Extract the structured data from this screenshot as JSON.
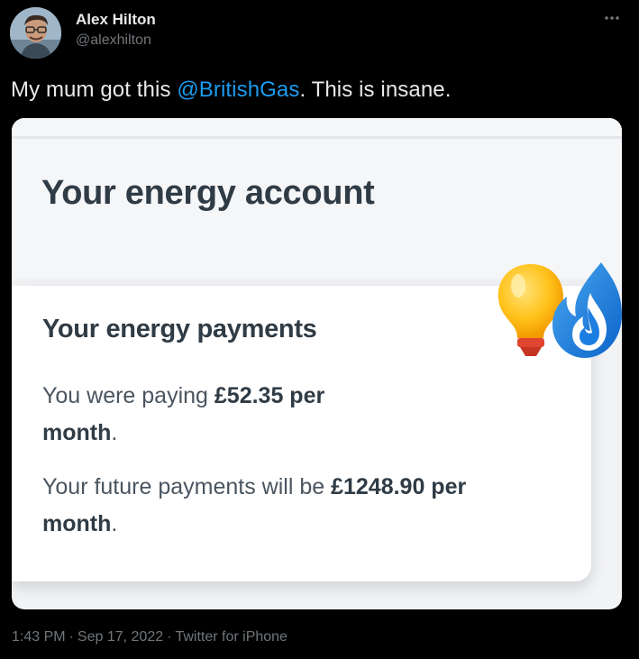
{
  "author": {
    "name": "Alex Hilton",
    "handle": "@alexhilton"
  },
  "tweet": {
    "text_before": "My mum got this ",
    "mention": "@BritishGas",
    "text_after": ". This is insane."
  },
  "media": {
    "account_title": "Your energy account",
    "payments_title": "Your energy payments",
    "line1_prefix": "You were paying ",
    "line1_amount": "£52.35 per",
    "line1_amount_cont": "month",
    "line1_suffix": ".",
    "line2_prefix": "Your future payments will be ",
    "line2_amount": "£1248.90 per",
    "line2_amount_cont": "month",
    "line2_suffix": ".",
    "icons": [
      "lightbulb-icon",
      "gas-flame-icon"
    ]
  },
  "footer": {
    "time": "1:43 PM",
    "separator": "·",
    "date": "Sep 17, 2022",
    "source": "Twitter for iPhone"
  },
  "colors": {
    "background": "#000000",
    "link": "#1d9bf0",
    "muted": "#71767b",
    "card_text": "#2f3b45"
  }
}
